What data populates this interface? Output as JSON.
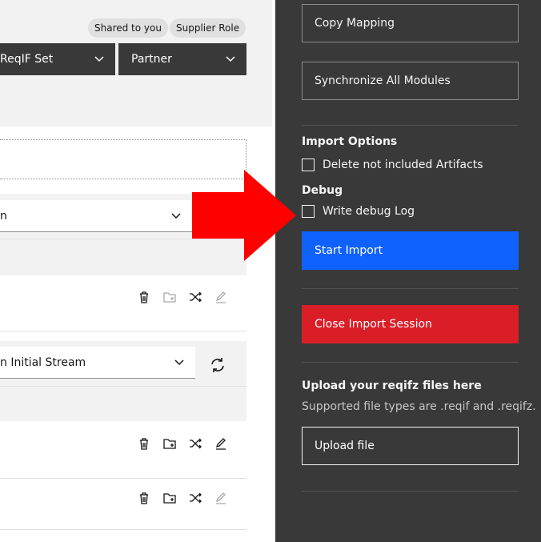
{
  "colors": {
    "panel_bg": "#393939",
    "primary": "#0f62fe",
    "danger": "#da1e28",
    "arrow": "#ff0000"
  },
  "header": {
    "tags": [
      "Shared to you",
      "Supplier Role"
    ],
    "reqif_set_label": "ReqIF Set",
    "partner_label": "Partner"
  },
  "list": {
    "select1_value": "n",
    "select2_value": "n Initial Stream"
  },
  "sidebar": {
    "copy_mapping": "Copy Mapping",
    "synchronize_all": "Synchronize All Modules",
    "import_options_title": "Import Options",
    "delete_not_included": "Delete not included Artifacts",
    "debug_title": "Debug",
    "write_debug_log": "Write debug Log",
    "start_import": "Start Import",
    "close_session": "Close Import Session",
    "upload_title": "Upload your reqifz files here",
    "upload_hint": "Supported file types are .reqif and .reqifz.",
    "upload_button": "Upload file"
  }
}
